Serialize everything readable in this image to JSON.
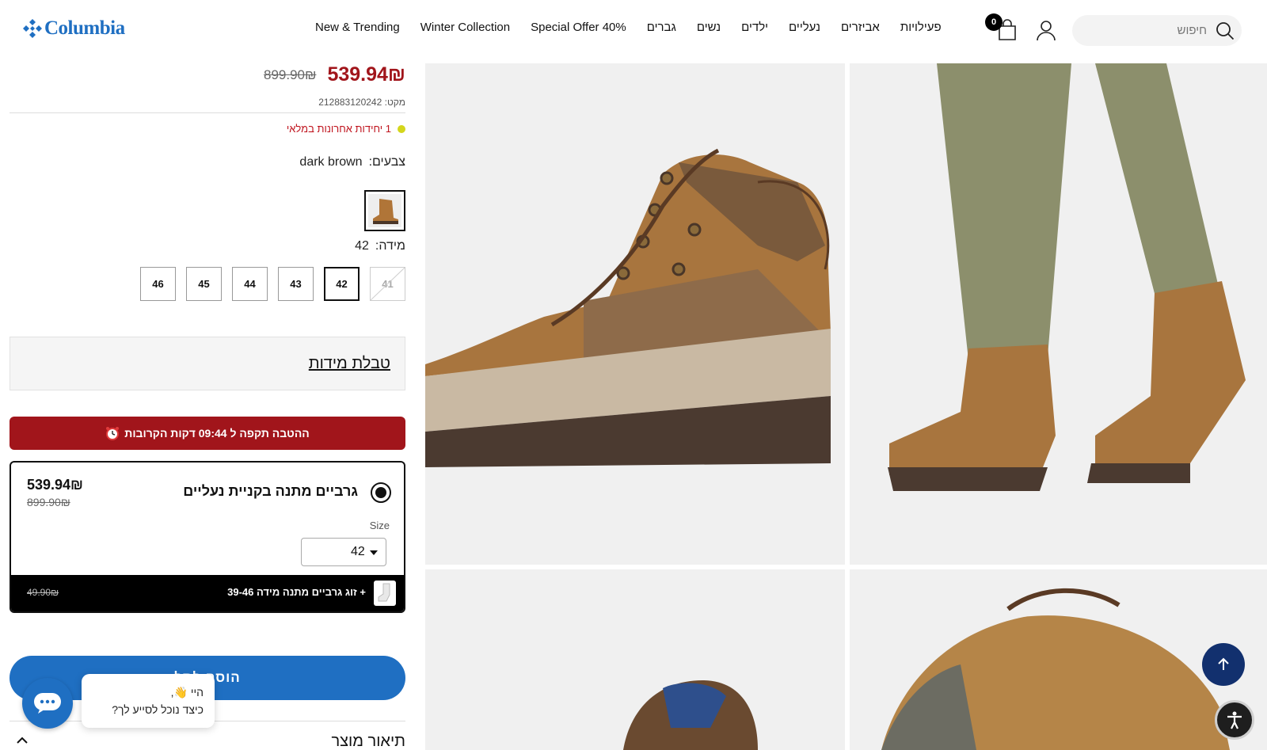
{
  "header": {
    "logo_text": "Columbia",
    "nav": [
      "פעילויות",
      "אביזרים",
      "נעליים",
      "ילדים",
      "נשים",
      "גברים",
      "Special Offer 40%",
      "Winter Collection",
      "New & Trending"
    ],
    "search_placeholder": "חיפוש",
    "cart_count": "0"
  },
  "product": {
    "sale_price": "539.94₪",
    "original_price": "899.90₪",
    "sku_label": "מקט:",
    "sku": "212883120242",
    "stock_text": "1 יחידות אחרונות במלאי",
    "color_label": "צבעים:",
    "color_value": "dark brown",
    "size_label": "מידה:",
    "size_value": "42",
    "sizes": [
      {
        "label": "41",
        "state": "unavailable"
      },
      {
        "label": "42",
        "state": "selected"
      },
      {
        "label": "43",
        "state": "available"
      },
      {
        "label": "44",
        "state": "available"
      },
      {
        "label": "45",
        "state": "available"
      },
      {
        "label": "46",
        "state": "available"
      }
    ],
    "size_chart_link": "טבלת מידות",
    "promo_text": "ההטבה תקפה ל 09:44 דקות הקרובות",
    "promo_icon": "alarm-clock-icon",
    "add_to_cart_label": "הוסף לסל",
    "description_title": "תיאור מוצר"
  },
  "bundle": {
    "title": "גרביים מתנה בקניית נעליים",
    "price": "539.94₪",
    "original_price": "899.90₪",
    "size_label": "Size",
    "size_value": "42",
    "sock_label": "+ זוג גרביים מתנה מידה 39-46",
    "sock_original_price": "49.90₪"
  },
  "chat": {
    "greeting_line1": "היי 👋,",
    "greeting_line2": "כיצד נוכל לסייע לך?"
  },
  "colors": {
    "brand_blue": "#1f6fc2",
    "sale_red": "#a1151b",
    "to_top_navy": "#12306e"
  }
}
